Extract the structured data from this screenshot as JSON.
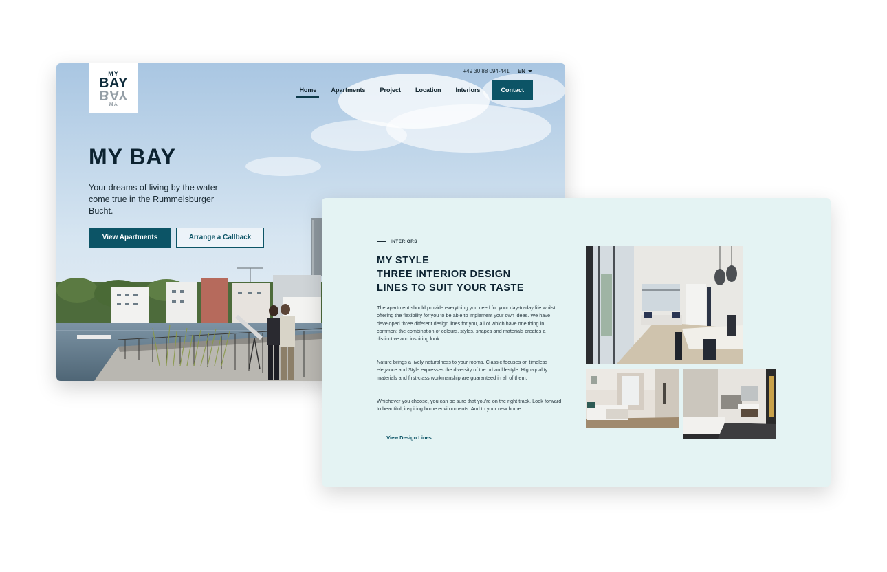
{
  "hero": {
    "logo": {
      "line1": "MY",
      "line2": "BAY",
      "mirror2": "BAY",
      "mirror1": "MY"
    },
    "phone": "+49 30 88 094-441",
    "language": "EN",
    "nav": [
      {
        "label": "Home",
        "active": true
      },
      {
        "label": "Apartments",
        "active": false
      },
      {
        "label": "Project",
        "active": false
      },
      {
        "label": "Location",
        "active": false
      },
      {
        "label": "Interiors",
        "active": false
      }
    ],
    "contact_label": "Contact",
    "title": "MY BAY",
    "subtitle": "Your dreams of living by the water come true in the Rummelsburger Bucht.",
    "primary_button": "View Apartments",
    "secondary_button": "Arrange a Callback"
  },
  "interiors": {
    "kicker": "INTERIORS",
    "title_line1": "MY STYLE",
    "title_line2": "THREE INTERIOR DESIGN",
    "title_line3": "LINES TO SUIT YOUR TASTE",
    "paragraph1": "The apartment should provide everything you need for your day-to-day life whilst offering the flexibility for you to be able to implement your own ideas. We have developed three different design lines for you, all of which have one thing in common: the combination of colours, styles, shapes and materials creates a distinctive and inspiring look.",
    "paragraph2": "Nature brings a lively naturalness to your rooms, Classic focuses on timeless elegance and Style expresses the diversity of the urban lifestyle. High-quality materials and first-class workmanship are guaranteed in all of them.",
    "paragraph3": "Whichever you choose, you can be sure that you're on the right track. Look forward to beautiful, inspiring home environments. And to your new home.",
    "button": "View Design Lines"
  },
  "colors": {
    "brand_teal": "#0c5466",
    "navy_text": "#0c2230",
    "interiors_bg": "#e4f3f3"
  }
}
